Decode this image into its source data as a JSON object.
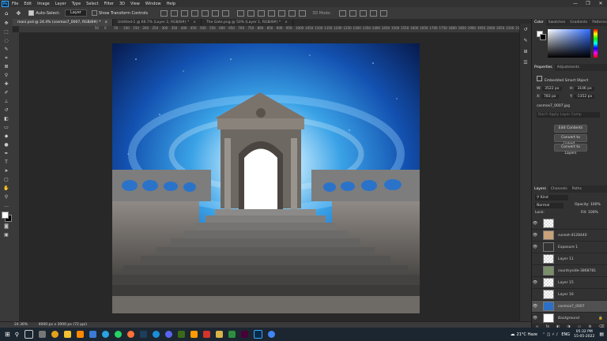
{
  "menubar": {
    "app_icon": "Ps",
    "items": [
      "File",
      "Edit",
      "Image",
      "Layer",
      "Type",
      "Select",
      "Filter",
      "3D",
      "View",
      "Window",
      "Help"
    ],
    "window_controls": [
      "—",
      "❐",
      "✕"
    ]
  },
  "options": {
    "auto_select_label": "Auto-Select:",
    "auto_select_value": "Layer",
    "transform_label": "Show Transform Controls",
    "mode_3d": "3D Mode:"
  },
  "tabs": [
    {
      "label": "mani.psd @ 24.4% (cosmos7_0007, RGB/8#) *",
      "active": true
    },
    {
      "label": "Untitled-1 @ 66.7% (Layer 2, RGB/8#) *",
      "active": false
    },
    {
      "label": "The Gate.png @ 50% (Layer 1, RGB/8#) *",
      "active": false
    }
  ],
  "ruler_ticks": [
    "50",
    "0",
    "50",
    "100",
    "150",
    "200",
    "250",
    "300",
    "350",
    "400",
    "450",
    "500",
    "550",
    "600",
    "650",
    "700",
    "750",
    "800",
    "850",
    "900",
    "950",
    "1000",
    "1050",
    "1100",
    "1150",
    "1200",
    "1250",
    "1300",
    "1350",
    "1400",
    "1450",
    "1500",
    "1550",
    "1600",
    "1650",
    "1700",
    "1750",
    "1800",
    "1850",
    "1900",
    "1950",
    "2000",
    "2050",
    "2100",
    "2150",
    "2200",
    "2250",
    "2300",
    "2350",
    "2400",
    "2450",
    "2500",
    "2550",
    "2600",
    "2650",
    "2700",
    "2750",
    "2800",
    "2850",
    "2900",
    "2950",
    "3000",
    "3050",
    "3100",
    "3150",
    "3200",
    "3250",
    "3300",
    "3350",
    "3400",
    "3450",
    "3500",
    "3550",
    "3600",
    "3650",
    "3700",
    "3750",
    "3800",
    "3850",
    "3900",
    "3950",
    "4000",
    "4050",
    "4100",
    "4150",
    "4200",
    "4250",
    "4300",
    "4350",
    "4400",
    "4450",
    "4500",
    "4550",
    "4600",
    "4650",
    "4700",
    "4750",
    "4800",
    "4850",
    "4900",
    "4950",
    "5000",
    "5050",
    "5100",
    "5150",
    "5200",
    "5250",
    "5300",
    "5350",
    "5400",
    "5450",
    "5500",
    "5550",
    "5600"
  ],
  "status": {
    "zoom": "24.36%",
    "info": "4000 px x 3000 px (72 ppi)"
  },
  "color_panel": {
    "tabs": [
      "Color",
      "Swatches",
      "Gradients",
      "Patterns"
    ]
  },
  "properties": {
    "tabs": [
      "Properties",
      "Adjustments"
    ],
    "type": "Embedded Smart Object",
    "w_label": "W:",
    "w_value": "3522 px",
    "h_label": "H:",
    "h_value": "3106 px",
    "x_label": "X:",
    "x_value": "783 px",
    "y_label": "Y:",
    "y_value": "-1352 px",
    "file": "cosmos7_0007.jpg",
    "comps_placeholder": "Don't Apply Layer Comp",
    "edit_button": "Edit Contents",
    "convert_linked": "Convert to Linked...",
    "convert_layers": "Convert to Layers"
  },
  "layers_panel": {
    "tabs": [
      "Layers",
      "Channels",
      "Paths"
    ],
    "kind": "Kind",
    "blend": "Normal",
    "opacity_label": "Opacity:",
    "opacity": "100%",
    "lock_label": "Lock:",
    "fill_label": "Fill:",
    "fill": "100%",
    "layers": [
      {
        "name": "",
        "visible": true
      },
      {
        "name": "sunset-4128440",
        "visible": true
      },
      {
        "name": "Exposure 1",
        "visible": true
      },
      {
        "name": "Layer 11",
        "visible": false
      },
      {
        "name": "countryside-3868781",
        "visible": false
      },
      {
        "name": "Layer 15",
        "visible": true
      },
      {
        "name": "Layer 16",
        "visible": false
      },
      {
        "name": "cosmos7_0007",
        "visible": true,
        "selected": true
      },
      {
        "name": "Background",
        "visible": true
      }
    ]
  },
  "taskbar": {
    "weather": "21°C Haze",
    "lang": "ENG",
    "time": "05:32 PM",
    "date": "15-05-2022"
  }
}
